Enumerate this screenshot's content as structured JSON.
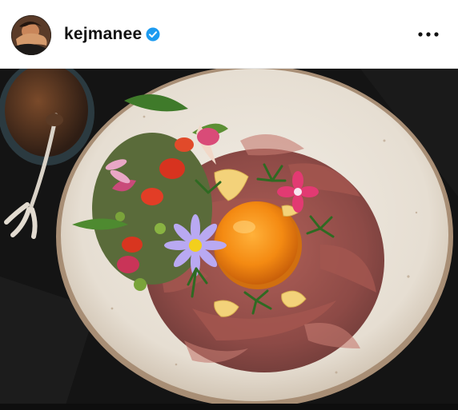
{
  "post": {
    "username": "kejmanee",
    "verified": true
  },
  "icons": {
    "verified": "verified-badge-icon",
    "more": "more-options-icon"
  },
  "colors": {
    "verified_blue": "#1d9bf0",
    "text": "#111111"
  }
}
